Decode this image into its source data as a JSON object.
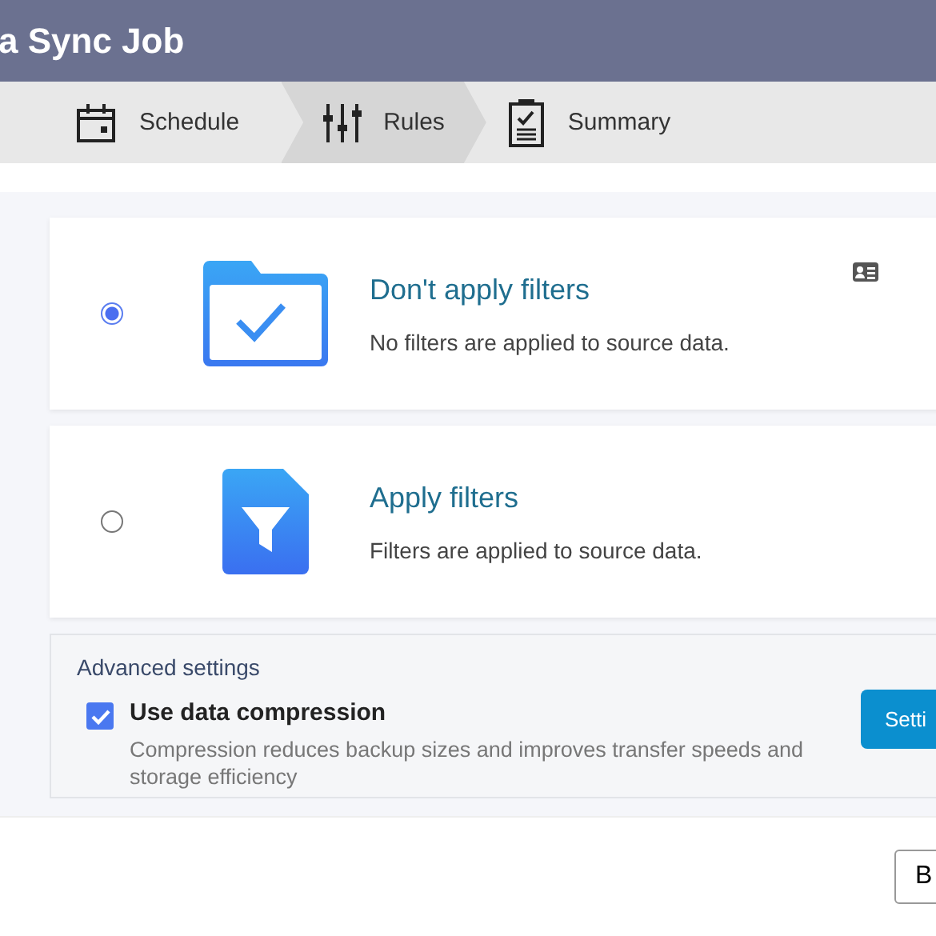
{
  "window": {
    "title": "a Sync Job"
  },
  "steps": [
    {
      "label": "Schedule",
      "kind": "calendar",
      "selected": false
    },
    {
      "label": "Rules",
      "kind": "sliders",
      "selected": true
    },
    {
      "label": "Summary",
      "kind": "clipboard",
      "selected": false
    }
  ],
  "options": [
    {
      "title": "Don't apply filters",
      "description": "No filters are applied to source data.",
      "kind": "folder",
      "selected": true
    },
    {
      "title": "Apply filters",
      "description": "Filters are applied to source data.",
      "kind": "funnel",
      "selected": false
    }
  ],
  "advanced": {
    "heading": "Advanced settings",
    "compression": {
      "label": "Use data compression",
      "description": "Compression reduces backup sizes and improves transfer speeds and storage efficiency",
      "checked": true
    },
    "button": "Setti"
  },
  "footer": {
    "button": "B"
  }
}
